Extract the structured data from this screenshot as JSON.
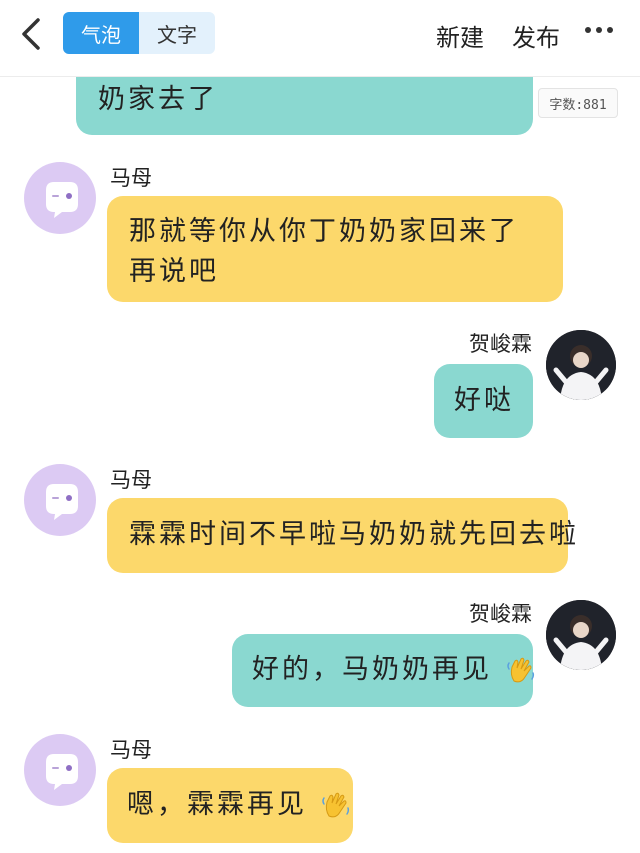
{
  "header": {
    "tab_bubble": "气泡",
    "tab_text": "文字",
    "new_label": "新建",
    "publish_label": "发布"
  },
  "word_count": "字数:881",
  "messages": [
    {
      "side": "right",
      "sender": "",
      "text": "奶家去了"
    },
    {
      "side": "left",
      "sender": "马母",
      "text": "那就等你从你丁奶奶家回来了再说吧"
    },
    {
      "side": "right",
      "sender": "贺峻霖",
      "text": "好哒"
    },
    {
      "side": "left",
      "sender": "马母",
      "text": "霖霖时间不早啦马奶奶就先回去啦"
    },
    {
      "side": "right",
      "sender": "贺峻霖",
      "text": "好的，马奶奶再见"
    },
    {
      "side": "left",
      "sender": "马母",
      "text": "嗯，霖霖再见"
    }
  ],
  "emoji": "waving-hand-icon",
  "colors": {
    "accent_blue": "#2f9bea",
    "mine_bubble": "#8ad8d0",
    "other_bubble": "#fcd86b",
    "ghost_avatar": "#dccaf3"
  }
}
